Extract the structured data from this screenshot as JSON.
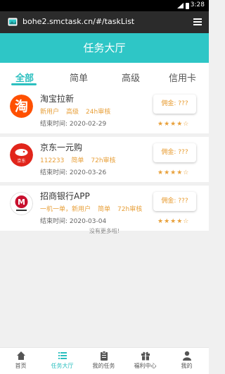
{
  "status": {
    "time": "3:28"
  },
  "browser": {
    "url": "bohe2.smctask.cn/#/taskList"
  },
  "header": {
    "title": "任务大厅"
  },
  "tabs": [
    {
      "label": "全部",
      "active": true
    },
    {
      "label": "简单",
      "active": false
    },
    {
      "label": "高级",
      "active": false
    },
    {
      "label": "信用卡",
      "active": false
    }
  ],
  "tasks": [
    {
      "title": "淘宝拉新",
      "tags": [
        "新用户",
        "高级",
        "24h审核"
      ],
      "end_date": "结束时间: 2020-02-29",
      "commission": "佣金: ???",
      "stars": "★★★★☆",
      "rating": 4,
      "logo_text": "淘"
    },
    {
      "title": "京东一元购",
      "tags": [
        "112233",
        "简单",
        "72h审核"
      ],
      "end_date": "结束时间: 2020-03-26",
      "commission": "佣金: ???",
      "stars": "★★★★☆",
      "rating": 4,
      "logo_text": "京东"
    },
    {
      "title": "招商银行APP",
      "tags": [
        "一机一单，新用户",
        "简单",
        "72h审核"
      ],
      "end_date": "结束时间: 2020-03-04",
      "commission": "佣金: ???",
      "stars": "★★★★☆",
      "rating": 4,
      "logo_text": "M"
    }
  ],
  "no_more": "没有更多啦!",
  "nav": [
    {
      "label": "首页",
      "icon": "home-icon",
      "active": false
    },
    {
      "label": "任务大厅",
      "icon": "list-icon",
      "active": true
    },
    {
      "label": "我的任务",
      "icon": "clipboard-icon",
      "active": false
    },
    {
      "label": "福利中心",
      "icon": "gift-icon",
      "active": false
    },
    {
      "label": "我的",
      "icon": "user-icon",
      "active": false
    }
  ],
  "colors": {
    "accent": "#2ec6c6",
    "tag": "#e8a03a",
    "commission": "#e89b2f",
    "taobao": "#ff5000",
    "jd": "#e1251b",
    "cmb": "#c8102e"
  }
}
